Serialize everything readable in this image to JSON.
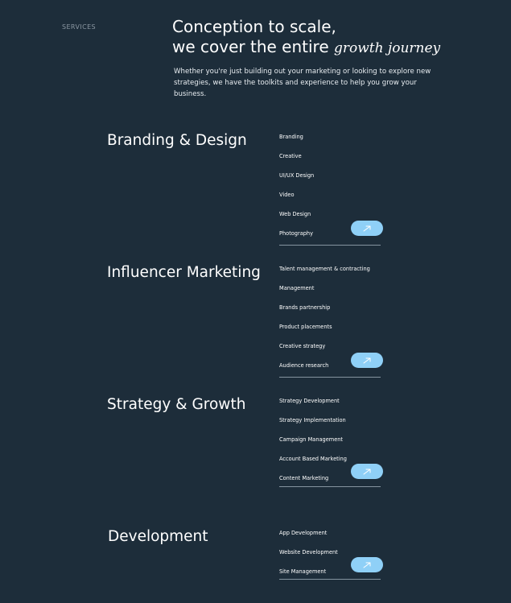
{
  "header": {
    "section_label": "SERVICES",
    "headline_line1": "Conception to scale,",
    "headline_line2_plain": "we cover the entire",
    "headline_line2_accent": "growth journey",
    "intro": "Whether you're just building out your marketing or looking to explore new strategies, we have the toolkits and experience to help you grow your business."
  },
  "services": [
    {
      "title": "Branding & Design",
      "items": [
        "Branding",
        "Creative",
        "UI/UX Design",
        "Video",
        "Web Design",
        "Photography"
      ]
    },
    {
      "title": "Influencer Marketing",
      "items": [
        "Talent management & contracting",
        "Management",
        "Brands partnership",
        "Product placements",
        "Creative strategy",
        "Audience research"
      ]
    },
    {
      "title": "Strategy & Growth",
      "items": [
        "Strategy Development",
        "Strategy Implementation",
        "Campaign Management",
        "Account Based Marketing",
        "Content Marketing"
      ]
    },
    {
      "title": "Development",
      "items": [
        "App Development",
        "Website Development",
        "Site Management"
      ]
    }
  ],
  "icons": {
    "arrow_button": "arrow-up-right-icon"
  },
  "colors": {
    "background": "#1d2d3a",
    "accent": "#8fd0f7",
    "muted_label": "#8a96a1",
    "rule": "#8594a0"
  }
}
